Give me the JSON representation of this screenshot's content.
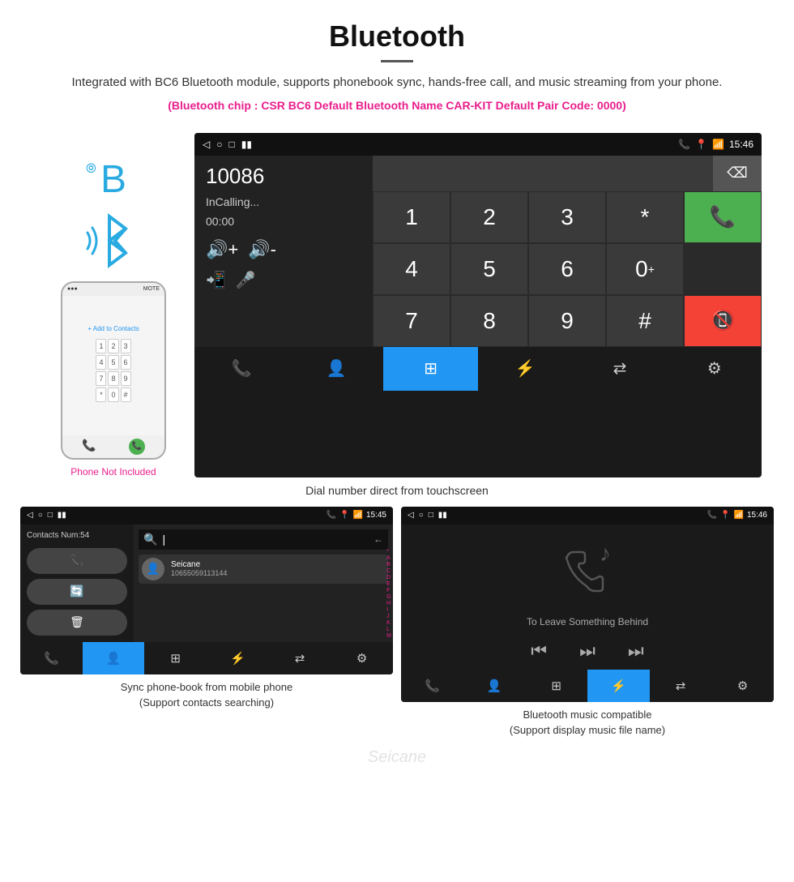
{
  "header": {
    "title": "Bluetooth",
    "description": "Integrated with BC6 Bluetooth module, supports phonebook sync, hands-free call, and music streaming from your phone.",
    "specs": "(Bluetooth chip : CSR BC6    Default Bluetooth Name CAR-KIT    Default Pair Code: 0000)"
  },
  "main_screen": {
    "status_bar": {
      "left": [
        "◁",
        "○",
        "□",
        "■▮"
      ],
      "right": [
        "📞",
        "📍",
        "📶",
        "15:46"
      ]
    },
    "dial_number": "10086",
    "calling_status": "InCalling...",
    "call_time": "00:00",
    "numpad": [
      "1",
      "2",
      "3",
      "*",
      "4",
      "5",
      "6",
      "0+",
      "7",
      "8",
      "9",
      "#"
    ],
    "caption": "Dial number direct from touchscreen"
  },
  "phone_left": {
    "not_included": "Phone Not Included",
    "screen_text": "Add to Contacts",
    "mini_keys": [
      "1",
      "2",
      "3",
      "4",
      "5",
      "6",
      "7",
      "8",
      "9",
      "*",
      "0",
      "#"
    ]
  },
  "phonebook_screen": {
    "status_bar_time": "15:45",
    "contacts_num": "Contacts Num:54",
    "contact_name": "Seicane",
    "contact_number": "10655059113144",
    "alpha_list": [
      "*",
      "A",
      "B",
      "C",
      "D",
      "E",
      "F",
      "G",
      "H",
      "I",
      "J",
      "K",
      "L",
      "M"
    ]
  },
  "music_screen": {
    "status_bar_time": "15:46",
    "song_title": "To Leave Something Behind"
  },
  "captions": {
    "phonebook": "Sync phone-book from mobile phone",
    "phonebook_sub": "(Support contacts searching)",
    "music": "Bluetooth music compatible",
    "music_sub": "(Support display music file name)"
  },
  "nav_items": {
    "phone": "📞",
    "contacts": "👤",
    "keypad": "⊞",
    "bluetooth": "⚡",
    "transfer": "⇄",
    "settings": "⚙"
  }
}
